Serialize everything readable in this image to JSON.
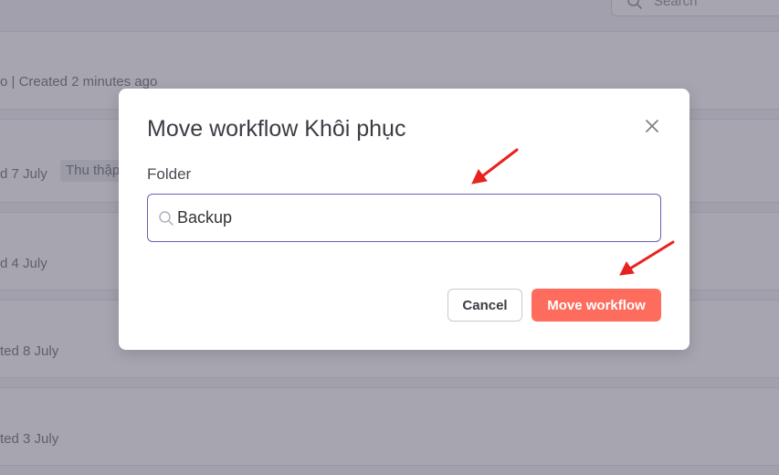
{
  "background": {
    "search_placeholder": "Search",
    "rows": [
      {
        "meta": "o | Created 2 minutes ago"
      },
      {
        "meta": "d 7 July",
        "tag": "Thu thập"
      },
      {
        "meta": "d 4 July"
      },
      {
        "meta": "ted 8 July"
      },
      {
        "meta": "ted 3 July"
      }
    ]
  },
  "dialog": {
    "title": "Move workflow Khôi phục",
    "folder_label": "Folder",
    "folder_value": "Backup",
    "cancel_label": "Cancel",
    "confirm_label": "Move workflow"
  },
  "colors": {
    "primary": "#fd6c5c",
    "input_border": "#6b5fb5",
    "annotation_arrow": "#e8231f"
  },
  "icons": {
    "close": "close-icon",
    "search": "search-icon"
  }
}
